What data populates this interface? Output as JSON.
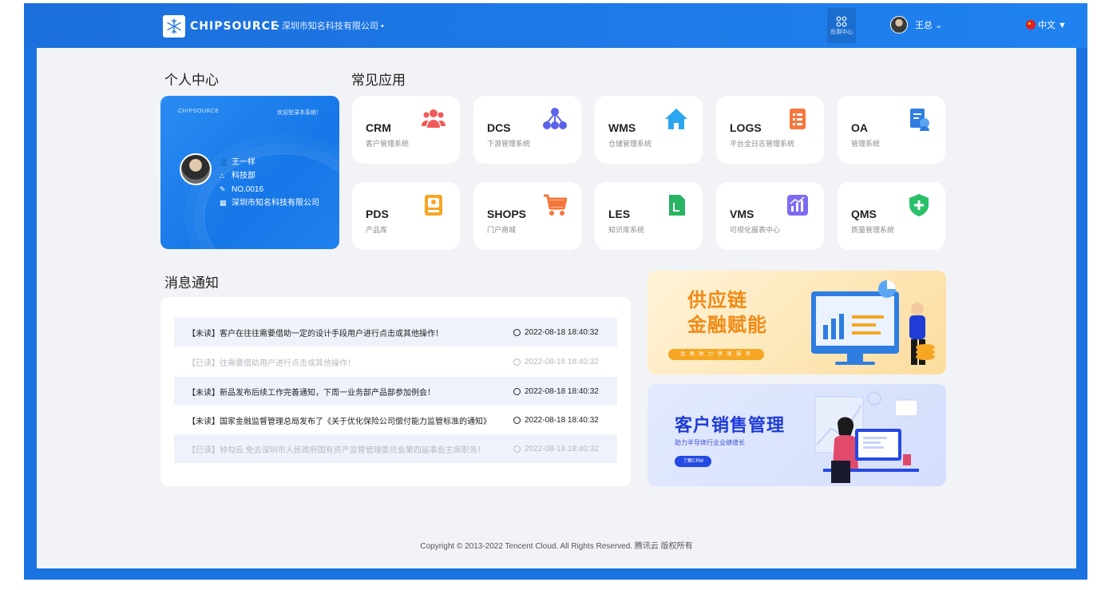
{
  "header": {
    "logo_text": "CHIPSOURCE",
    "company": "•  深圳市知名科技有限公司  •",
    "apps_label": "应用中心",
    "user_name": "王总 ⌄",
    "language": "中文 ▼"
  },
  "profile": {
    "section_title": "个人中心",
    "brand": "CHIPSOURCE",
    "welcome": "欢迎登录本系统！",
    "name": "王一样",
    "department": "科技部",
    "number": "NO.0016",
    "company": "深圳市知名科技有限公司"
  },
  "apps": {
    "section_title": "常见应用",
    "items": [
      {
        "code": "CRM",
        "desc": "客户管理系统",
        "icon": "people-icon",
        "color": "#f05a5a"
      },
      {
        "code": "DCS",
        "desc": "下游管理系统",
        "icon": "hierarchy-icon",
        "color": "#5b63e8"
      },
      {
        "code": "WMS",
        "desc": "仓储管理系统",
        "icon": "home-icon",
        "color": "#2da6f0"
      },
      {
        "code": "LOGS",
        "desc": "平台全日志管理系统",
        "icon": "list-icon",
        "color": "#f5763b"
      },
      {
        "code": "OA",
        "desc": "管理系统",
        "icon": "document-icon",
        "color": "#2f7de1"
      },
      {
        "code": "PDS",
        "desc": "产品库",
        "icon": "book-icon",
        "color": "#f5a623"
      },
      {
        "code": "SHOPS",
        "desc": "门户商城",
        "icon": "cart-icon",
        "color": "#f5763b"
      },
      {
        "code": "LES",
        "desc": "知识库系统",
        "icon": "file-icon",
        "color": "#28b463"
      },
      {
        "code": "VMS",
        "desc": "可视化报表中心",
        "icon": "chart-icon",
        "color": "#7d6cf0"
      },
      {
        "code": "QMS",
        "desc": "质量管理系统",
        "icon": "shield-icon",
        "color": "#2bc06a"
      }
    ]
  },
  "notices": {
    "section_title": "消息通知",
    "items": [
      {
        "text": "【未读】客户在往往需要借助一定的设计手段用户进行点击或其他操作！",
        "time": "2022-08-18  18:40:32",
        "read": false
      },
      {
        "text": "【已读】往需要借助用户进行点击或其他操作！",
        "time": "2022-08-18  18:40:32",
        "read": true
      },
      {
        "text": "【未读】新品发布后续工作完善通知，下周一业务部产品部参加例会！",
        "time": "2022-08-18  18:40:32",
        "read": false
      },
      {
        "text": "【未读】国家金融监督管理总局发布了《关于优化保险公司偿付能力监管标准的通知》",
        "time": "2022-08-18  18:40:32",
        "read": false
      },
      {
        "text": "【已读】钟勾云  免去深圳市人民政府国有资产监督管理委员会第四届事会主席职务！",
        "time": "2022-08-18  18:40:32",
        "read": true
      }
    ]
  },
  "banner_finance": {
    "title_line1": "供应链",
    "title_line2": "金融赋能",
    "pill": "金 融 助 力 快 速 服 务"
  },
  "banner_sales": {
    "title": "客户销售管理",
    "subtitle": "助力半导体行业业绩增长",
    "button": "了解CRM"
  },
  "footer": {
    "copyright": "Copyright © 2013-2022 Tencent Cloud. All Rights Reserved. 腾讯云 版权所有"
  }
}
